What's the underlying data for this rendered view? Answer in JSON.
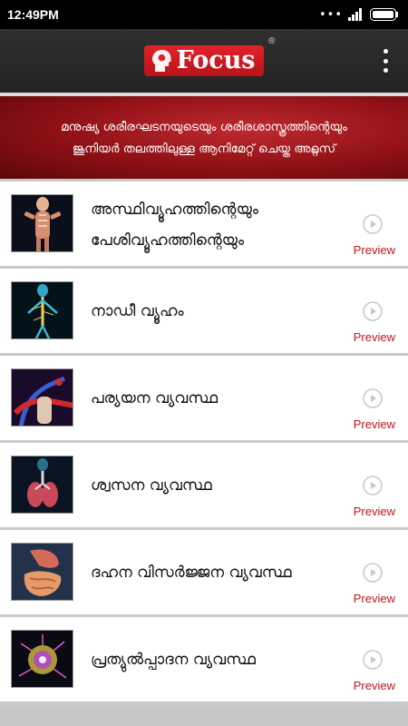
{
  "status_bar": {
    "time": "12:49PM"
  },
  "app_bar": {
    "logo_text": "Focus",
    "registered_mark": "®"
  },
  "banner": {
    "line1": "മനുഷ്യ ശരീരഘടനയുടെയും ശരീരശാസ്ത്രത്തിന്റെയും",
    "line2": "ജൂനിയർ തലത്തിലുള്ള ആനിമേറ്റ് ചെയ്ത അറ്റ്ലസ്"
  },
  "items": [
    {
      "title_line1": "അസ്ഥിവ്യൂഹത്തിന്റെയും",
      "title_line2": "പേശിവ്യൂഹത്തിന്റെയും",
      "preview": "Preview",
      "icon": "skeleton-muscle-thumbnail"
    },
    {
      "title_line1": "നാഡീ വ്യൂഹം",
      "title_line2": "",
      "preview": "Preview",
      "icon": "nervous-system-thumbnail"
    },
    {
      "title_line1": "പര്യയന വ്യവസ്ഥ",
      "title_line2": "",
      "preview": "Preview",
      "icon": "circulatory-system-thumbnail"
    },
    {
      "title_line1": "ശ്വസന വ്യവസ്ഥ",
      "title_line2": "",
      "preview": "Preview",
      "icon": "respiratory-system-thumbnail"
    },
    {
      "title_line1": "ദഹന വിസർജ്ജന വ്യവസ്ഥ",
      "title_line2": "",
      "preview": "Preview",
      "icon": "digestive-system-thumbnail"
    },
    {
      "title_line1": "പ്രത്യുൽപ്പാദന വ്യവസ്ഥ",
      "title_line2": "",
      "preview": "Preview",
      "icon": "reproductive-system-thumbnail"
    }
  ],
  "colors": {
    "accent_red": "#c4121a",
    "app_bar": "#2a2a2a",
    "banner_red": "#9b1419"
  }
}
